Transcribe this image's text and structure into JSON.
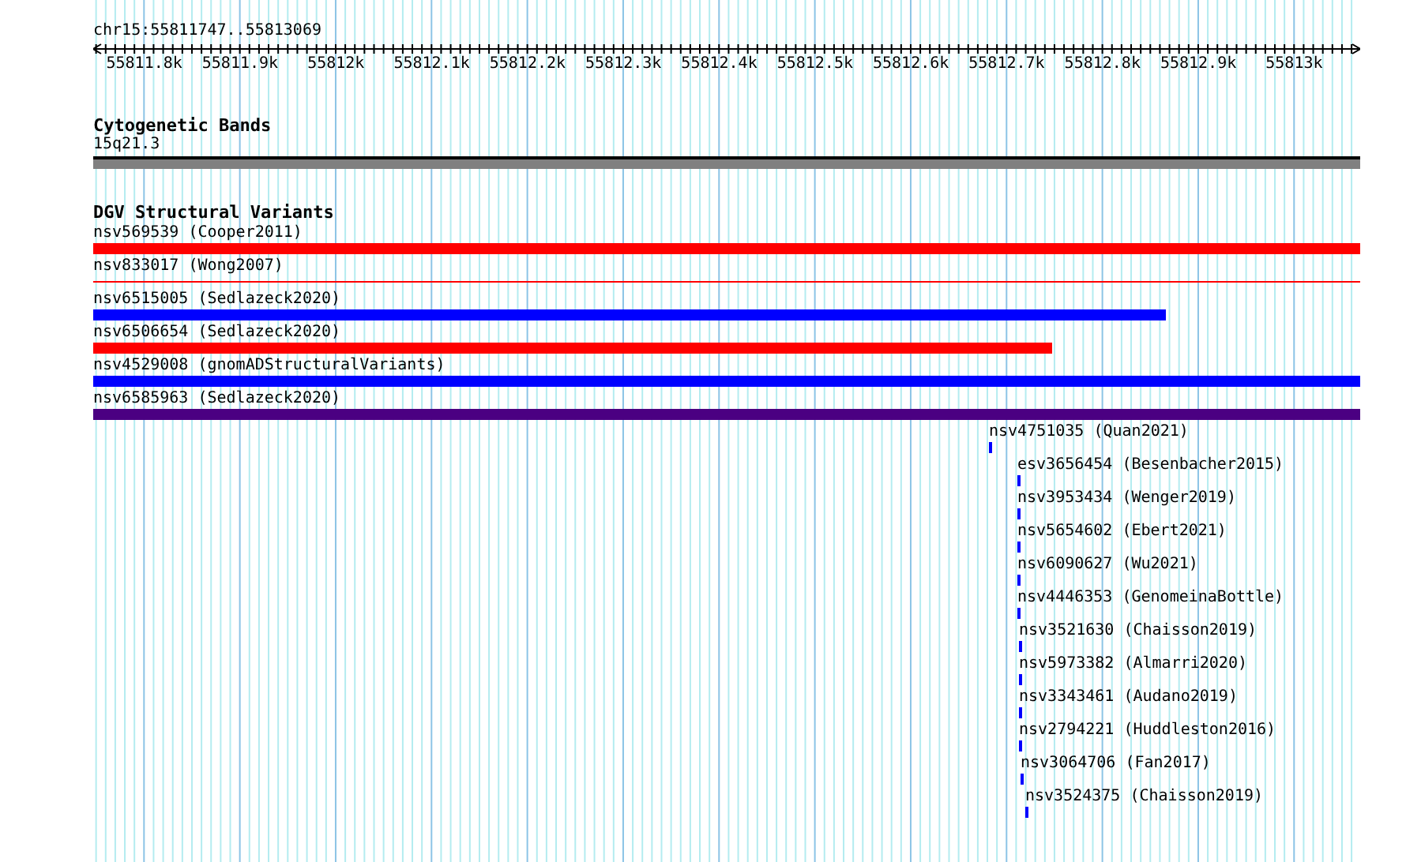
{
  "location": "chr15:55811747..55813069",
  "ruler": {
    "ticks": [
      "55811.8k",
      "55811.9k",
      "55812k",
      "55812.1k",
      "55812.2k",
      "55812.3k",
      "55812.4k",
      "55812.5k",
      "55812.6k",
      "55812.7k",
      "55812.8k",
      "55812.9k",
      "55813k"
    ]
  },
  "cytoband_track": {
    "title": "Cytogenetic Bands",
    "band": "15q21.3"
  },
  "variant_track": {
    "title": "DGV Structural Variants",
    "features": [
      {
        "label": "nsv569539 (Cooper2011)",
        "kind": "bar",
        "color": "#ff0000"
      },
      {
        "label": "nsv833017 (Wong2007)",
        "kind": "line",
        "color": "#ff0000"
      },
      {
        "label": "nsv6515005 (Sedlazeck2020)",
        "kind": "bar",
        "color": "#0000ff"
      },
      {
        "label": "nsv6506654 (Sedlazeck2020)",
        "kind": "bar",
        "color": "#ff0000"
      },
      {
        "label": "nsv4529008 (gnomADStructuralVariants)",
        "kind": "bar",
        "color": "#0000ff"
      },
      {
        "label": "nsv6585963 (Sedlazeck2020)",
        "kind": "bar",
        "color": "#4b0082"
      },
      {
        "label": "nsv4751035 (Quan2021)",
        "kind": "bar",
        "color": "#0000ff"
      },
      {
        "label": "esv3656454 (Besenbacher2015)",
        "kind": "bar",
        "color": "#0000ff"
      },
      {
        "label": "nsv3953434 (Wenger2019)",
        "kind": "bar",
        "color": "#0000ff"
      },
      {
        "label": "nsv5654602 (Ebert2021)",
        "kind": "bar",
        "color": "#0000ff"
      },
      {
        "label": "nsv6090627 (Wu2021)",
        "kind": "bar",
        "color": "#0000ff"
      },
      {
        "label": "nsv4446353 (GenomeinaBottle)",
        "kind": "bar",
        "color": "#0000ff"
      },
      {
        "label": "nsv3521630 (Chaisson2019)",
        "kind": "bar",
        "color": "#0000ff"
      },
      {
        "label": "nsv5973382 (Almarri2020)",
        "kind": "bar",
        "color": "#0000ff"
      },
      {
        "label": "nsv3343461 (Audano2019)",
        "kind": "bar",
        "color": "#0000ff"
      },
      {
        "label": "nsv2794221 (Huddleston2016)",
        "kind": "bar",
        "color": "#0000ff"
      },
      {
        "label": "nsv3064706 (Fan2017)",
        "kind": "bar",
        "color": "#0000ff"
      },
      {
        "label": "nsv3524375 (Chaisson2019)",
        "kind": "bar",
        "color": "#0000ff"
      }
    ]
  }
}
